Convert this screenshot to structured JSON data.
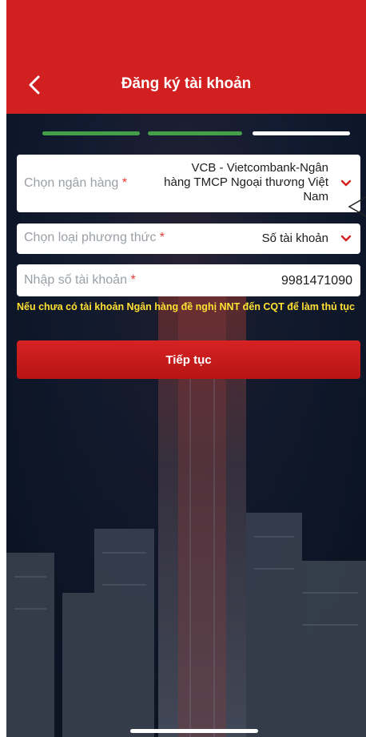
{
  "header": {
    "title": "Đăng ký tài khoản",
    "back_icon": "chevron-left-icon"
  },
  "progress": {
    "steps_total": 3,
    "steps_completed": 2,
    "colors": {
      "done": "#43a047",
      "current": "#ffffff"
    }
  },
  "form": {
    "bank": {
      "label": "Chọn ngân hàng",
      "required_mark": "*",
      "value_lines": [
        "VCB - Vietcombank-Ngân",
        "hàng TMCP Ngoại thương Việt",
        "Nam"
      ]
    },
    "method": {
      "label": "Chọn loại phương thức",
      "required_mark": "*",
      "value": "Số tài khoản"
    },
    "account": {
      "label": "Nhập số tài khoản",
      "required_mark": "*",
      "value": "9981471090"
    }
  },
  "note": "Nếu chưa có tài khoản Ngân hàng đề nghị NNT đến CQT để làm thủ tục",
  "actions": {
    "continue_label": "Tiếp tục"
  },
  "theme": {
    "primary": "#d21f1f",
    "note_color": "#ffe033",
    "required_color": "#e53935"
  }
}
